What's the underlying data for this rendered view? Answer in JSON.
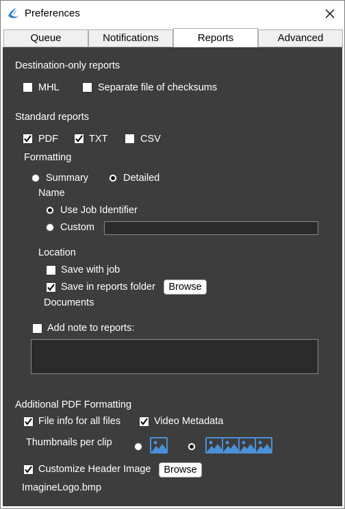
{
  "window": {
    "title": "Preferences",
    "icon": "app-logo-icon",
    "close_icon": "close-icon"
  },
  "tabs": [
    {
      "label": "Queue",
      "active": false
    },
    {
      "label": "Notifications",
      "active": false
    },
    {
      "label": "Reports",
      "active": true
    },
    {
      "label": "Advanced",
      "active": false
    }
  ],
  "destination": {
    "heading": "Destination-only reports",
    "mhl": {
      "label": "MHL",
      "checked": false
    },
    "separate": {
      "label": "Separate file of checksums",
      "checked": false
    }
  },
  "standard": {
    "heading": "Standard reports",
    "pdf": {
      "label": "PDF",
      "checked": true
    },
    "txt": {
      "label": "TXT",
      "checked": true
    },
    "csv": {
      "label": "CSV",
      "checked": false
    },
    "formatting_label": "Formatting",
    "summary": {
      "label": "Summary",
      "selected": false
    },
    "detailed": {
      "label": "Detailed",
      "selected": true
    },
    "name_label": "Name",
    "use_job": {
      "label": "Use Job Identifier",
      "selected": true
    },
    "custom": {
      "label": "Custom",
      "selected": false,
      "value": ""
    },
    "location_label": "Location",
    "save_with_job": {
      "label": "Save with job",
      "checked": false
    },
    "save_in_folder": {
      "label": "Save in reports folder",
      "checked": true
    },
    "browse_label": "Browse",
    "folder_value": "Documents",
    "add_note": {
      "label": "Add note to reports:",
      "checked": false,
      "value": ""
    }
  },
  "additional": {
    "heading": "Additional PDF Formatting",
    "file_info": {
      "label": "File info for all files",
      "checked": true
    },
    "video_meta": {
      "label": "Video Metadata",
      "checked": true
    },
    "thumbs_label": "Thumbnails per clip",
    "thumb_one": {
      "icon": "image-icon",
      "count": 1,
      "selected": false
    },
    "thumb_four": {
      "icon": "image-icon",
      "count": 4,
      "selected": true
    },
    "header_image": {
      "label": "Customize Header Image",
      "checked": true
    },
    "browse_label": "Browse",
    "header_file": "ImagineLogo.bmp"
  }
}
